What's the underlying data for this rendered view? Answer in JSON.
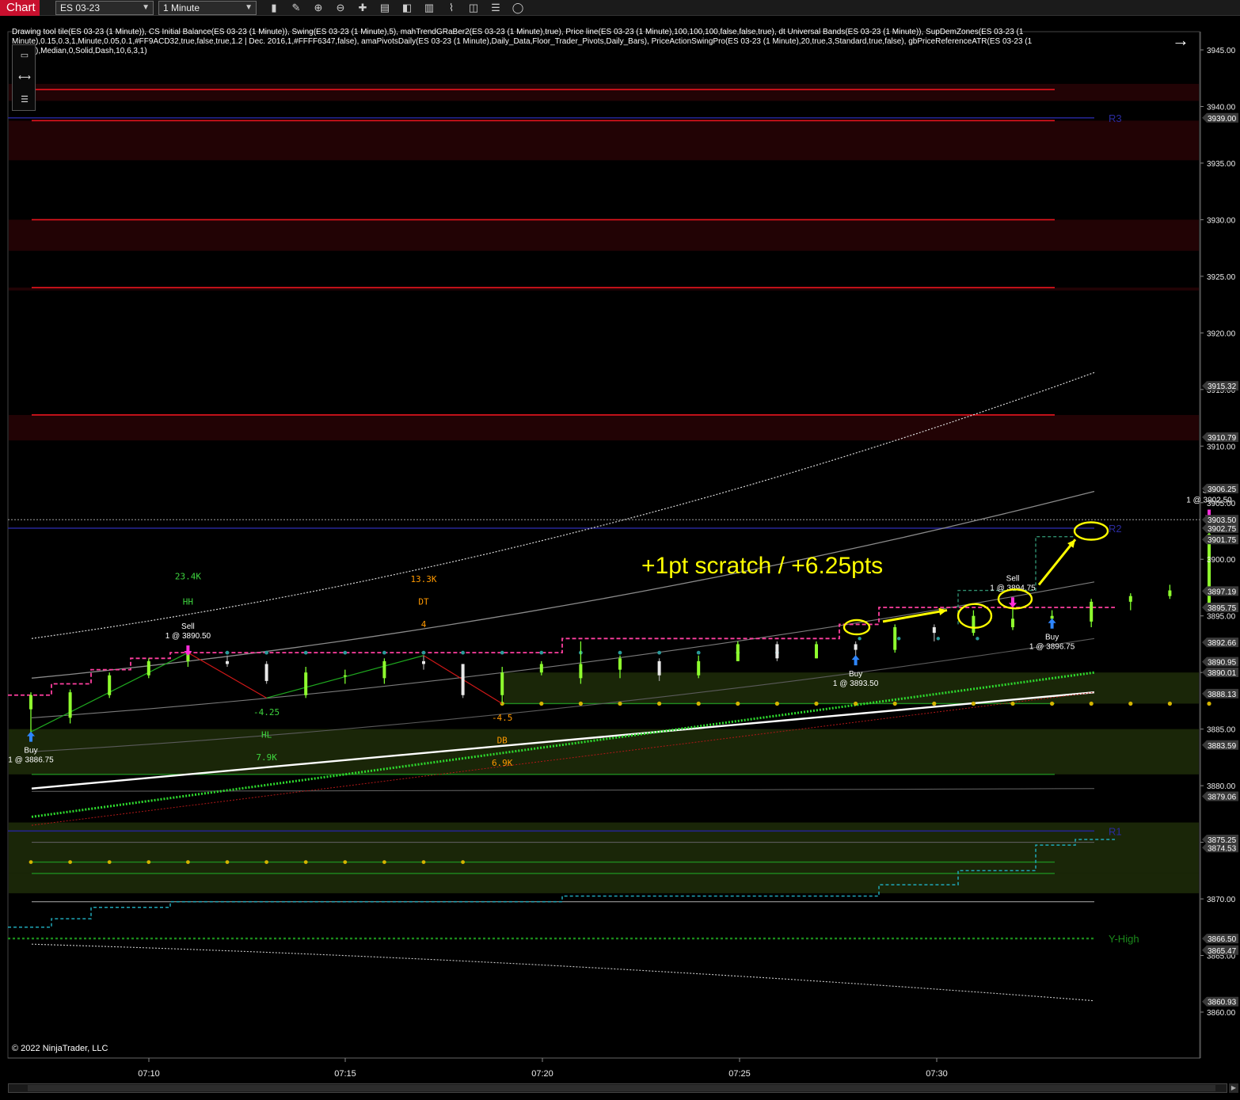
{
  "toolbar": {
    "tab_label": "Chart",
    "instrument": "ES 03-23",
    "interval": "1 Minute",
    "icons": [
      "bars-type-icon",
      "pencil-draw-icon",
      "zoom-in-icon",
      "zoom-out-icon",
      "crosshair-icon",
      "properties-icon",
      "layout-icon",
      "strategies-icon",
      "indicators-icon",
      "data-series-icon",
      "templates-icon",
      "clock-icon"
    ]
  },
  "legend_text": "Drawing tool tile(ES 03-23 (1 Minute)), CS Initial Balance(ES 03-23 (1 Minute)), Swing(ES 03-23 (1 Minute),5), mahTrendGRaBer2(ES 03-23 (1 Minute),true), Price line(ES 03-23 (1 Minute),100,100,100,false,false,true), dt Universal Bands(ES 03-23 (1 Minute)), SupDemZones(ES 03-23 (1 Minute),0.15,0.3,1,Minute,0.05,0.1,#FF9ACD32,true,false,true,1.2 | Dec. 2016,1,#FFFF6347,false), amaPivotsDaily(ES 03-23 (1 Minute),Daily_Data,Floor_Trader_Pivots,Daily_Bars), PriceActionSwingPro(ES 03-23 (1 Minute),20,true,3,Standard,true,false), gbPriceReferenceATR(ES 03-23 (1 Minute),Median,0,Solid,Dash,10,6,3,1)",
  "copyright": "© 2022 NinjaTrader, LLC",
  "annotation": "+1pt scratch / +6.25pts",
  "chart_data": {
    "type": "candlestick",
    "instrument": "ES 03-23",
    "interval": "1 Minute",
    "time_axis": {
      "labels": [
        "07:10",
        "07:15",
        "07:20",
        "07:25",
        "07:30"
      ]
    },
    "price_axis": {
      "range": [
        3857.5,
        3947.5
      ],
      "ticks": [
        "3945.00",
        "3940.00",
        "3935.00",
        "3930.00",
        "3925.00",
        "3920.00",
        "3915.00",
        "3910.00",
        "3905.00",
        "3900.00",
        "3895.00",
        "3890.00",
        "3885.00",
        "3880.00",
        "3875.00",
        "3870.00",
        "3865.00",
        "3860.00"
      ],
      "markers": [
        {
          "label": "3939.00",
          "value": 3939.0,
          "color": "#3a3a3a"
        },
        {
          "label": "3915.32",
          "value": 3915.32,
          "color": "#3a3a3a"
        },
        {
          "label": "3910.79",
          "value": 3910.79,
          "color": "#3a3a3a"
        },
        {
          "label": "3906.25",
          "value": 3906.25,
          "color": "#3a3a3a"
        },
        {
          "label": "3903.50",
          "value": 3903.5,
          "color": "#3a3a3a"
        },
        {
          "label": "3902.75",
          "value": 3902.75,
          "color": "#3a3a3a"
        },
        {
          "label": "3901.75",
          "value": 3901.75,
          "color": "#3a3a3a"
        },
        {
          "label": "3897.19",
          "value": 3897.19,
          "color": "#3a3a3a"
        },
        {
          "label": "3895.75",
          "value": 3895.75,
          "color": "#3a3a3a"
        },
        {
          "label": "3892.66",
          "value": 3892.66,
          "color": "#3a3a3a"
        },
        {
          "label": "3890.95",
          "value": 3890.95,
          "color": "#3a3a3a"
        },
        {
          "label": "3890.01",
          "value": 3890.01,
          "color": "#3a3a3a"
        },
        {
          "label": "3888.13",
          "value": 3888.13,
          "color": "#3a3a3a"
        },
        {
          "label": "3883.59",
          "value": 3883.59,
          "color": "#3a3a3a"
        },
        {
          "label": "3879.06",
          "value": 3879.06,
          "color": "#3a3a3a"
        },
        {
          "label": "3875.25",
          "value": 3875.25,
          "color": "#3a3a3a"
        },
        {
          "label": "3874.53",
          "value": 3874.53,
          "color": "#3a3a3a"
        },
        {
          "label": "3866.50",
          "value": 3866.5,
          "color": "#3a3a3a"
        },
        {
          "label": "3865.47",
          "value": 3865.47,
          "color": "#3a3a3a"
        },
        {
          "label": "3860.93",
          "value": 3860.93,
          "color": "#3a3a3a"
        }
      ]
    },
    "pivots": [
      {
        "label": "R3",
        "value": 3939.0
      },
      {
        "label": "R2",
        "value": 3902.75
      },
      {
        "label": "R1",
        "value": 3876.0
      },
      {
        "label": "Y-High",
        "value": 3866.5
      }
    ],
    "supply_zones": [
      {
        "top": 3942.0,
        "bottom": 3940.5,
        "line": 3941.5
      },
      {
        "top": 3938.75,
        "bottom": 3935.25,
        "line": 3938.75
      },
      {
        "top": 3930.0,
        "bottom": 3927.25,
        "line": 3930.0
      },
      {
        "top": 3924.0,
        "bottom": 3923.75,
        "line": 3924.0
      },
      {
        "top": 3912.75,
        "bottom": 3910.5,
        "line": 3912.75
      }
    ],
    "demand_zones": [
      {
        "top": 3890.0,
        "bottom": 3887.25,
        "line": 3887.25
      },
      {
        "top": 3885.0,
        "bottom": 3881.0,
        "line": 3881.0
      },
      {
        "top": 3876.75,
        "bottom": 3872.25,
        "line": 3873.25
      },
      {
        "top": 3872.25,
        "bottom": 3870.5,
        "line": 3872.25
      }
    ],
    "candles": [
      {
        "o": 3886.75,
        "h": 3888.25,
        "l": 3884.75,
        "c": 3888.0
      },
      {
        "o": 3886.0,
        "h": 3888.5,
        "l": 3885.5,
        "c": 3888.25
      },
      {
        "o": 3888.0,
        "h": 3890.0,
        "l": 3887.75,
        "c": 3889.75
      },
      {
        "o": 3889.75,
        "h": 3891.25,
        "l": 3889.5,
        "c": 3891.0
      },
      {
        "o": 3891.0,
        "h": 3892.0,
        "l": 3890.5,
        "c": 3891.75
      },
      {
        "o": 3891.0,
        "h": 3891.5,
        "l": 3890.5,
        "c": 3890.75
      },
      {
        "o": 3890.75,
        "h": 3891.0,
        "l": 3889.0,
        "c": 3889.25
      },
      {
        "o": 3888.0,
        "h": 3890.5,
        "l": 3887.75,
        "c": 3890.0
      },
      {
        "o": 3889.75,
        "h": 3890.25,
        "l": 3889.0,
        "c": 3889.75
      },
      {
        "o": 3889.5,
        "h": 3891.25,
        "l": 3889.0,
        "c": 3891.0
      },
      {
        "o": 3891.0,
        "h": 3891.5,
        "l": 3890.25,
        "c": 3890.75
      },
      {
        "o": 3890.75,
        "h": 3890.75,
        "l": 3887.75,
        "c": 3888.0
      },
      {
        "o": 3888.0,
        "h": 3890.5,
        "l": 3887.25,
        "c": 3890.0
      },
      {
        "o": 3890.0,
        "h": 3891.0,
        "l": 3889.75,
        "c": 3890.75
      },
      {
        "o": 3889.5,
        "h": 3892.75,
        "l": 3889.0,
        "c": 3890.75
      },
      {
        "o": 3890.25,
        "h": 3891.5,
        "l": 3889.5,
        "c": 3891.25
      },
      {
        "o": 3891.0,
        "h": 3891.25,
        "l": 3889.25,
        "c": 3889.75
      },
      {
        "o": 3889.75,
        "h": 3891.5,
        "l": 3889.5,
        "c": 3891.0
      },
      {
        "o": 3891.0,
        "h": 3892.75,
        "l": 3891.0,
        "c": 3892.5
      },
      {
        "o": 3892.5,
        "h": 3892.75,
        "l": 3891.0,
        "c": 3891.25
      },
      {
        "o": 3891.25,
        "h": 3892.75,
        "l": 3891.25,
        "c": 3892.5
      },
      {
        "o": 3892.5,
        "h": 3892.75,
        "l": 3891.5,
        "c": 3892.0
      },
      {
        "o": 3892.0,
        "h": 3894.25,
        "l": 3891.75,
        "c": 3894.0
      },
      {
        "o": 3894.0,
        "h": 3894.25,
        "l": 3892.75,
        "c": 3893.5
      },
      {
        "o": 3893.5,
        "h": 3895.5,
        "l": 3893.25,
        "c": 3895.0
      },
      {
        "o": 3894.0,
        "h": 3895.75,
        "l": 3893.75,
        "c": 3894.75
      },
      {
        "o": 3894.75,
        "h": 3895.5,
        "l": 3894.25,
        "c": 3895.0
      },
      {
        "o": 3894.5,
        "h": 3896.5,
        "l": 3894.0,
        "c": 3896.25
      },
      {
        "o": 3896.25,
        "h": 3897.0,
        "l": 3895.5,
        "c": 3896.75
      },
      {
        "o": 3896.75,
        "h": 3897.75,
        "l": 3896.5,
        "c": 3897.25
      },
      {
        "o": 3896.0,
        "h": 3902.75,
        "l": 3895.75,
        "c": 3902.25
      },
      {
        "o": 3902.5,
        "h": 3903.5,
        "l": 3901.0,
        "c": 3901.75
      }
    ],
    "trades": [
      {
        "side": "Buy",
        "label": "Buy",
        "detail": "1 @ 3886.75",
        "bar": 0,
        "price": 3886.75
      },
      {
        "side": "Sell",
        "label": "Sell",
        "detail": "1 @ 3890.50",
        "bar": 4,
        "price": 3890.5
      },
      {
        "side": "Buy",
        "label": "Buy",
        "detail": "1 @ 3893.50",
        "bar": 21,
        "price": 3893.5
      },
      {
        "side": "Sell",
        "label": "Sell",
        "detail": "1 @ 3894.75",
        "bar": 25,
        "price": 3894.75
      },
      {
        "side": "Buy",
        "label": "Buy",
        "detail": "1 @ 3896.75",
        "bar": 26,
        "price": 3896.75
      },
      {
        "side": "Sell",
        "label": "Sell",
        "detail": "1 @ 3902.50",
        "bar": 30,
        "price": 3902.5
      }
    ],
    "swing_labels": [
      {
        "text": "23.4K",
        "bar": 4,
        "price": 3898.25,
        "color": "#3ed43e"
      },
      {
        "text": "HH",
        "bar": 4,
        "price": 3896.0,
        "color": "#3ed43e"
      },
      {
        "text": "-4.25",
        "bar": 6,
        "price": 3886.25,
        "color": "#3ed43e"
      },
      {
        "text": "HL",
        "bar": 6,
        "price": 3884.25,
        "color": "#3ed43e"
      },
      {
        "text": "7.9K",
        "bar": 6,
        "price": 3882.25,
        "color": "#3ed43e"
      },
      {
        "text": "13.3K",
        "bar": 10,
        "price": 3898.0,
        "color": "#ff9900"
      },
      {
        "text": "DT",
        "bar": 10,
        "price": 3896.0,
        "color": "#ff9900"
      },
      {
        "text": "4",
        "bar": 10,
        "price": 3894.0,
        "color": "#ff9900"
      },
      {
        "text": "-4.5",
        "bar": 12,
        "price": 3885.75,
        "color": "#ff9900"
      },
      {
        "text": "DB",
        "bar": 12,
        "price": 3883.75,
        "color": "#ff9900"
      },
      {
        "text": "6.9K",
        "bar": 12,
        "price": 3881.75,
        "color": "#ff9900"
      }
    ],
    "colors": {
      "up": "#8fff2e",
      "down": "#e8e8e8",
      "supply": "#c8141e",
      "demand": "#3f5a14",
      "trend": "#ff3fa0",
      "fast_ma": "#2edb2e",
      "slow_ma": "#ffffff",
      "pivot": "#24248c",
      "highlight": "#ffff00"
    }
  }
}
